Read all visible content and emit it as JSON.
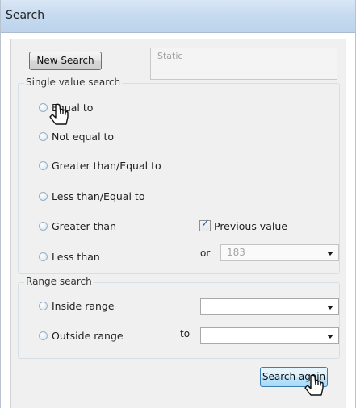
{
  "window": {
    "title": "Search"
  },
  "toolbar": {
    "new_search_label": "New Search",
    "static_text": "Static"
  },
  "single_value_search": {
    "group_label": "Single value search",
    "options": [
      "Equal to",
      "Not equal to",
      "Greater than/Equal to",
      "Less than/Equal to",
      "Greater than",
      "Less than"
    ],
    "previous_value_label": "Previous value",
    "previous_value_checked": true,
    "or_label": "or",
    "value_combo": "183"
  },
  "range_search": {
    "group_label": "Range search",
    "options": [
      "Inside range",
      "Outside range"
    ],
    "to_label": "to"
  },
  "footer": {
    "search_again_label": "Search again"
  },
  "icons": {
    "checkbox_mark": "✓",
    "pointer": "mouse-pointer-icon"
  },
  "colors": {
    "titlebar": "#c7dbf0",
    "dialog_bg": "#f0f0f0",
    "accent_button_border": "#3c7fb1"
  }
}
